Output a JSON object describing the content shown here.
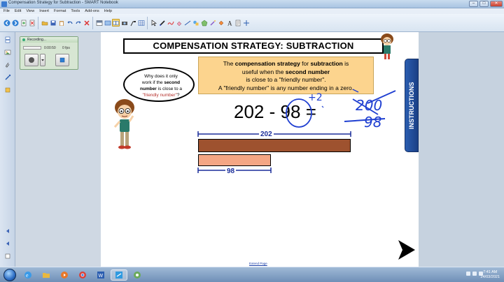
{
  "window": {
    "title": "Compensation Strategy for Subtraction - SMART Notebook",
    "buttons": {
      "minimize": "–",
      "maximize": "□",
      "close": "✕"
    }
  },
  "menu": [
    "File",
    "Edit",
    "View",
    "Insert",
    "Format",
    "Tools",
    "Add-ons",
    "Help"
  ],
  "toolbar": {
    "icons": [
      "previous-page-icon",
      "next-page-icon",
      "add-page-icon",
      "delete-page-icon",
      "open-icon",
      "save-icon",
      "paste-icon",
      "undo-icon",
      "redo-icon",
      "delete-icon",
      "screen-shade-icon",
      "full-screen-icon",
      "dual-page-icon",
      "capture-icon",
      "document-camera-icon",
      "table-icon",
      "select-icon",
      "pen-icon",
      "creative-pen-icon",
      "eraser-icon",
      "line-icon",
      "shapes-icon",
      "regular-polygon-icon",
      "magic-pen-icon",
      "fill-icon",
      "text-icon",
      "properties-icon",
      "move-toolbar-icon"
    ],
    "selected": "pen-icon"
  },
  "recorder": {
    "title": "Recording...",
    "time": "0:00:50",
    "status": "0 fps",
    "record_icon": "record-icon",
    "dropdown_icon": "chevron-down-icon",
    "stop_icon": "stop-icon"
  },
  "slide": {
    "heading": "COMPENSATION STRATEGY: SUBTRACTION",
    "info_lines": [
      [
        "The ",
        "compensation strategy",
        " for ",
        "subtraction",
        " is"
      ],
      [
        "useful when the ",
        "second number"
      ],
      [
        "is close to a \"friendly number\"."
      ],
      [
        "A \"friendly number\" is any number ending in a zero."
      ]
    ],
    "speech": {
      "line1": "Why does it only",
      "line2": "work if the",
      "bold": "second",
      "line3": "number",
      "line4": "is close to a",
      "red": "\"friendly number\"",
      "end": "?"
    },
    "equation": {
      "a": "202",
      "op": "-",
      "b": "98",
      "eq": "="
    },
    "annotation_plus": "+2",
    "scribble_top": "200",
    "scribble_bottom": "98",
    "bar_label_top": "202",
    "bar_label_bottom": "98",
    "instructions_tab": "INSTRUCTIONS",
    "extend_page": "Extend Page"
  },
  "colors": {
    "bar_202": "#9e522f",
    "bar_98": "#f4a684",
    "info_box": "#fcd48e",
    "label_blue": "#1a2d9a",
    "ink_blue": "#1f3fd1",
    "instructions_tab": "#2a5db0"
  },
  "taskbar": {
    "clock_time": "7:41 AM",
    "clock_date": "24/03/2021"
  }
}
